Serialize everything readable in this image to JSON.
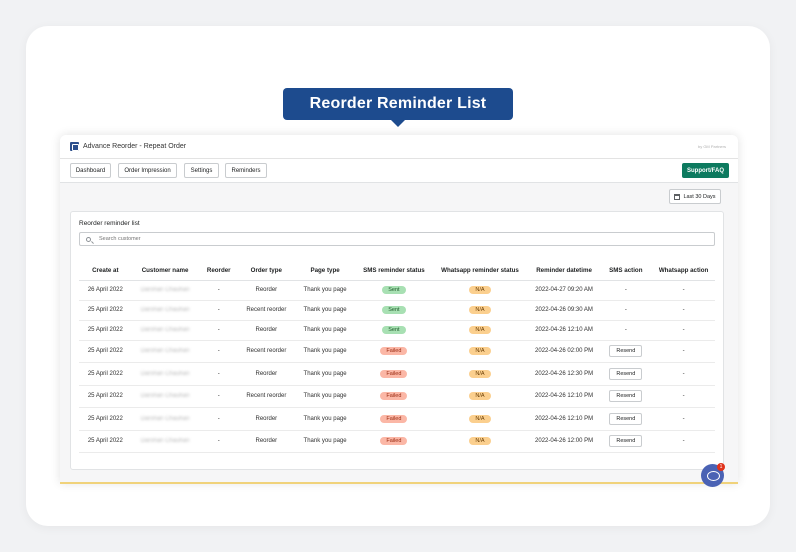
{
  "banner": {
    "title": "Reorder Reminder List"
  },
  "app": {
    "title": "Advance Reorder - Repeat Order",
    "user_label": "by GM Partners"
  },
  "nav": {
    "dashboard": "Dashboard",
    "order_impression": "Order Impression",
    "settings": "Settings",
    "reminders": "Reminders",
    "support": "Support/FAQ"
  },
  "filter": {
    "date_range": "Last 30 Days"
  },
  "panel": {
    "title": "Reorder reminder list",
    "search_placeholder": "Search customer"
  },
  "table": {
    "headers": [
      "Create at",
      "Customer name",
      "Reorder",
      "Order type",
      "Page type",
      "SMS reminder status",
      "Whatsapp reminder status",
      "Reminder datetime",
      "SMS action",
      "Whatsapp action"
    ],
    "rows": [
      {
        "created": "26 April 2022",
        "customer": "Darshan Chauhan",
        "reorder": "-",
        "order_type": "Reorder",
        "page_type": "Thank you page",
        "sms_status": "Sent",
        "wa_status": "N/A",
        "datetime": "2022-04-27 09:20 AM",
        "sms_action": "-",
        "wa_action": "-"
      },
      {
        "created": "25 April 2022",
        "customer": "Darshan Chauhan",
        "reorder": "-",
        "order_type": "Recent reorder",
        "page_type": "Thank you page",
        "sms_status": "Sent",
        "wa_status": "N/A",
        "datetime": "2022-04-26 09:30 AM",
        "sms_action": "-",
        "wa_action": "-"
      },
      {
        "created": "25 April 2022",
        "customer": "Darshan Chauhan",
        "reorder": "-",
        "order_type": "Reorder",
        "page_type": "Thank you page",
        "sms_status": "Sent",
        "wa_status": "N/A",
        "datetime": "2022-04-26 12:10 AM",
        "sms_action": "-",
        "wa_action": "-"
      },
      {
        "created": "25 April 2022",
        "customer": "Darshan Chauhan",
        "reorder": "-",
        "order_type": "Recent reorder",
        "page_type": "Thank you page",
        "sms_status": "Failed",
        "wa_status": "N/A",
        "datetime": "2022-04-26 02:00 PM",
        "sms_action": "Resend",
        "wa_action": "-"
      },
      {
        "created": "25 April 2022",
        "customer": "Darshan Chauhan",
        "reorder": "-",
        "order_type": "Reorder",
        "page_type": "Thank you page",
        "sms_status": "Failed",
        "wa_status": "N/A",
        "datetime": "2022-04-26 12:30 PM",
        "sms_action": "Resend",
        "wa_action": "-"
      },
      {
        "created": "25 April 2022",
        "customer": "Darshan Chauhan",
        "reorder": "-",
        "order_type": "Recent reorder",
        "page_type": "Thank you page",
        "sms_status": "Failed",
        "wa_status": "N/A",
        "datetime": "2022-04-26 12:10 PM",
        "sms_action": "Resend",
        "wa_action": "-"
      },
      {
        "created": "25 April 2022",
        "customer": "Darshan Chauhan",
        "reorder": "-",
        "order_type": "Reorder",
        "page_type": "Thank you page",
        "sms_status": "Failed",
        "wa_status": "N/A",
        "datetime": "2022-04-26 12:10 PM",
        "sms_action": "Resend",
        "wa_action": "-"
      },
      {
        "created": "25 April 2022",
        "customer": "Darshan Chauhan",
        "reorder": "-",
        "order_type": "Reorder",
        "page_type": "Thank you page",
        "sms_status": "Failed",
        "wa_status": "N/A",
        "datetime": "2022-04-26 12:00 PM",
        "sms_action": "Resend",
        "wa_action": "-"
      }
    ]
  },
  "chat": {
    "unread_count": "1"
  },
  "colors": {
    "banner": "#1d4b8e",
    "support": "#0d7a5f",
    "sent": "#a8e0b3",
    "failed": "#fbb7a6",
    "na": "#fbcf8e",
    "chat": "#4a62b4"
  }
}
